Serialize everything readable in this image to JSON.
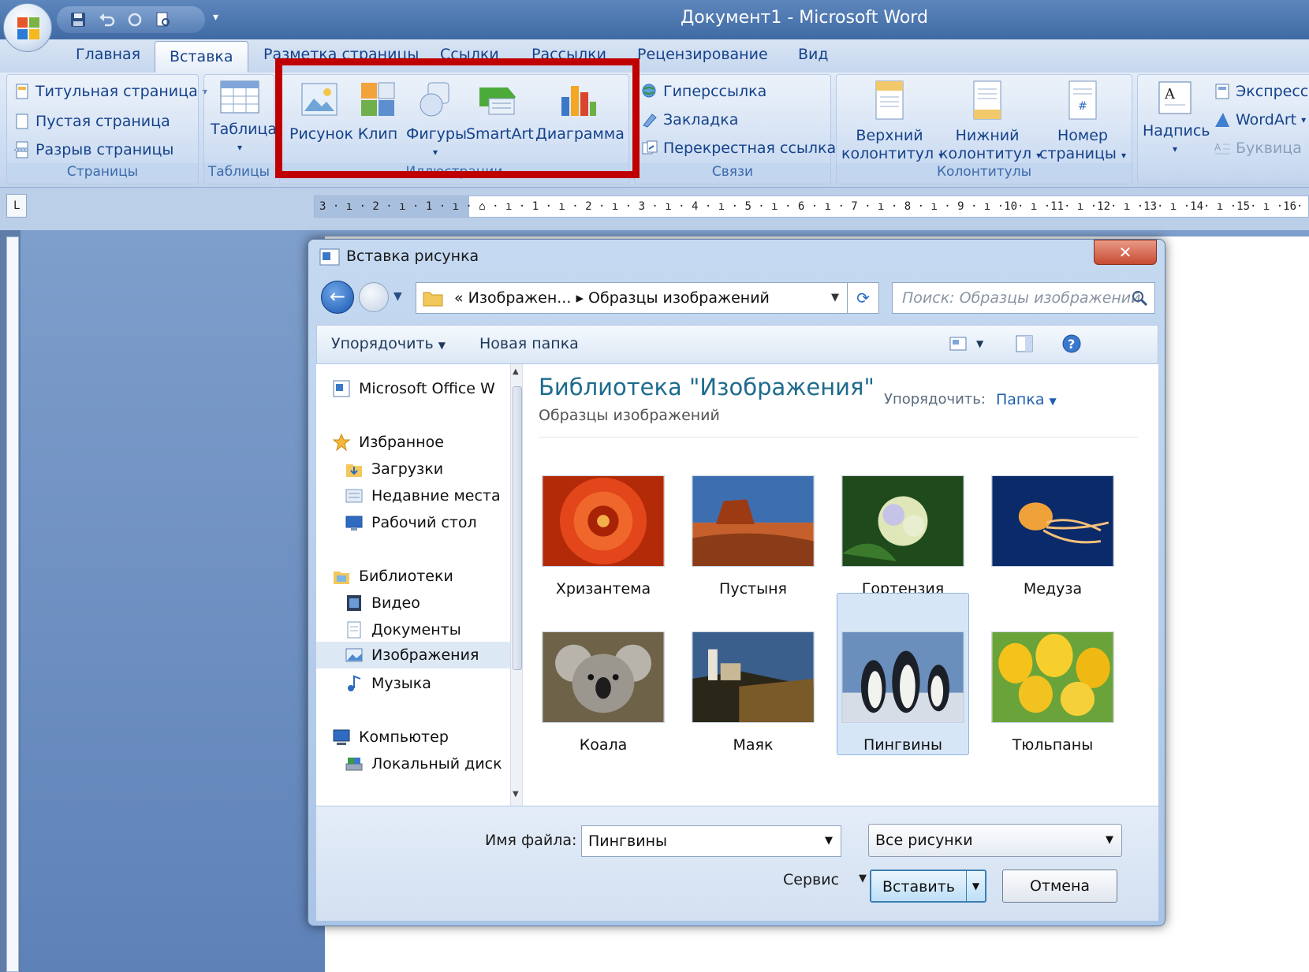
{
  "window": {
    "title": "Документ1 - Microsoft Word"
  },
  "tabs": [
    "Главная",
    "Вставка",
    "Разметка страницы",
    "Ссылки",
    "Рассылки",
    "Рецензирование",
    "Вид"
  ],
  "ribbon": {
    "pages": {
      "items": [
        "Титульная страница",
        "Пустая страница",
        "Разрыв страницы"
      ],
      "label": "Страницы"
    },
    "tables": {
      "button": "Таблица",
      "label": "Таблицы"
    },
    "illustrations": {
      "items": [
        "Рисунок",
        "Клип",
        "Фигуры",
        "SmartArt",
        "Диаграмма"
      ],
      "label": "Иллюстрации"
    },
    "links": {
      "items": [
        "Гиперссылка",
        "Закладка",
        "Перекрестная ссылка"
      ],
      "label": "Связи"
    },
    "headers": {
      "header_1": "Верхний",
      "header_2": "колонтитул",
      "footer_1": "Нижний",
      "footer_2": "колонтитул",
      "pagenum_1": "Номер",
      "pagenum_2": "страницы",
      "label": "Колонтитулы"
    },
    "text": {
      "textbox": "Надпись",
      "items": [
        "Экспресс-",
        "WordArt",
        "Буквица"
      ]
    }
  },
  "ruler": {
    "text": "3 · ı · 2 · ı · 1 · ı · ⌂ · ı · 1 · ı · 2 · ı · 3 · ı · 4 · ı · 5 · ı · 6 · ı · 7 · ı · 8 · ı · 9 · ı ·10· ı ·11· ı ·12· ı ·13· ı ·14· ı ·15· ı ·16·",
    "corner": "L"
  },
  "dialog": {
    "title": "Вставка рисунка",
    "close": "✕",
    "address": {
      "prefix": "«",
      "crumb1": "Изображен...",
      "sep": "▸",
      "crumb2": "Образцы изображений"
    },
    "search_placeholder": "Поиск: Образцы изображений",
    "toolbar": {
      "organize": "Упорядочить",
      "new_folder": "Новая папка"
    },
    "nav": [
      {
        "label": "Microsoft Office W",
        "icon": "word-doc-icon"
      },
      {
        "label": "Избранное",
        "icon": "star-icon"
      },
      {
        "label": "Загрузки",
        "icon": "downloads-icon"
      },
      {
        "label": "Недавние места",
        "icon": "recent-icon"
      },
      {
        "label": "Рабочий стол",
        "icon": "desktop-icon"
      },
      {
        "label": "Библиотеки",
        "icon": "libraries-icon"
      },
      {
        "label": "Видео",
        "icon": "video-icon"
      },
      {
        "label": "Документы",
        "icon": "documents-icon"
      },
      {
        "label": "Изображения",
        "icon": "pictures-icon"
      },
      {
        "label": "Музыка",
        "icon": "music-icon"
      },
      {
        "label": "Компьютер",
        "icon": "computer-icon"
      },
      {
        "label": "Локальный диск",
        "icon": "disk-icon"
      }
    ],
    "library_title": "Библиотека \"Изображения\"",
    "library_subtitle": "Образцы изображений",
    "arrange_label": "Упорядочить:",
    "arrange_value": "Папка",
    "files": [
      "Хризантема",
      "Пустыня",
      "Гортензия",
      "Медуза",
      "Коала",
      "Маяк",
      "Пингвины",
      "Тюльпаны"
    ],
    "selected_file": "Пингвины",
    "filename_label": "Имя файла:",
    "filename_value": "Пингвины",
    "filter_value": "Все рисунки",
    "service": "Сервис",
    "insert": "Вставить",
    "cancel": "Отмена"
  },
  "colors": {
    "highlight": "#c00000",
    "accent": "#15428b",
    "library_title": "#1e6b8e"
  }
}
